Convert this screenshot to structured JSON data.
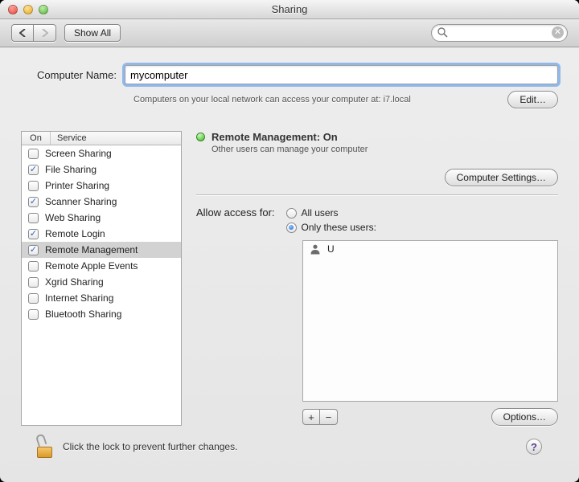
{
  "window": {
    "title": "Sharing"
  },
  "toolbar": {
    "show_all": "Show All",
    "search_placeholder": ""
  },
  "computer_name": {
    "label": "Computer Name:",
    "value": "mycomputer",
    "hint": "Computers on your local network can access your computer at: i7.local",
    "edit": "Edit…"
  },
  "services": {
    "headers": {
      "on": "On",
      "service": "Service"
    },
    "items": [
      {
        "label": "Screen Sharing",
        "on": false,
        "selected": false
      },
      {
        "label": "File Sharing",
        "on": true,
        "selected": false
      },
      {
        "label": "Printer Sharing",
        "on": false,
        "selected": false
      },
      {
        "label": "Scanner Sharing",
        "on": true,
        "selected": false
      },
      {
        "label": "Web Sharing",
        "on": false,
        "selected": false
      },
      {
        "label": "Remote Login",
        "on": true,
        "selected": false
      },
      {
        "label": "Remote Management",
        "on": true,
        "selected": true
      },
      {
        "label": "Remote Apple Events",
        "on": false,
        "selected": false
      },
      {
        "label": "Xgrid Sharing",
        "on": false,
        "selected": false
      },
      {
        "label": "Internet Sharing",
        "on": false,
        "selected": false
      },
      {
        "label": "Bluetooth Sharing",
        "on": false,
        "selected": false
      }
    ]
  },
  "detail": {
    "status_title": "Remote Management: On",
    "status_sub": "Other users can manage your computer",
    "computer_settings": "Computer Settings…",
    "allow_label": "Allow access for:",
    "radio_all": "All users",
    "radio_only": "Only these users:",
    "radio_selected": "only",
    "users": [
      {
        "name": "U"
      }
    ],
    "options": "Options…"
  },
  "footer": {
    "lock_text": "Click the lock to prevent further changes.",
    "help": "?"
  }
}
